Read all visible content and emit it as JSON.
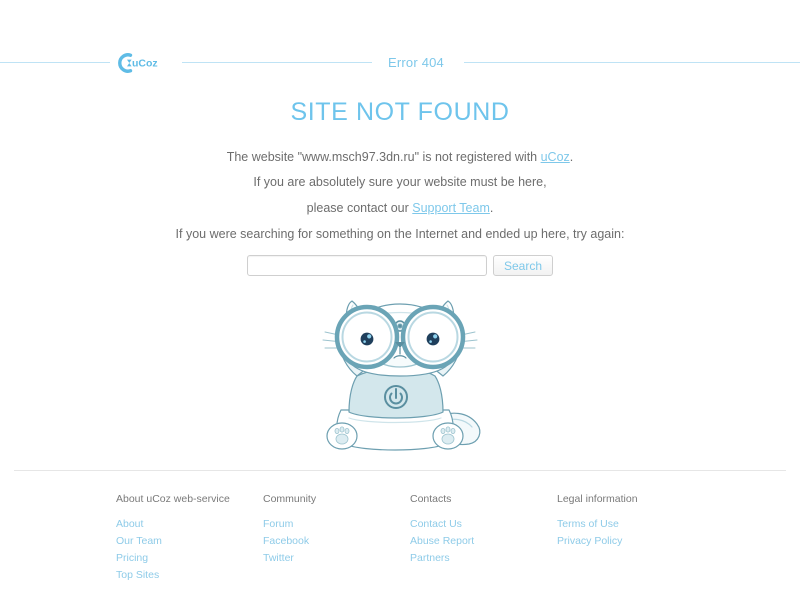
{
  "header": {
    "logo_text": "uCoz",
    "logo_icon": "ucoz-logo-icon",
    "error_code": "Error 404"
  },
  "main": {
    "title": "SITE NOT FOUND",
    "line1_prefix": "The website \"www.msch97.3dn.ru\" is not registered with ",
    "line1_link": "uCoz",
    "line1_suffix": ".",
    "line2": "If you are absolutely sure your website must be here,",
    "line3_prefix": "please contact our ",
    "line3_link": "Support Team",
    "line3_suffix": ".",
    "line4": "If you were searching for something on the Internet and ended up here, try again:"
  },
  "search": {
    "value": "",
    "placeholder": "",
    "button_label": "Search"
  },
  "mascot": {
    "name": "ucoz-cat-mascot",
    "shirt_logo": "ucoz-power-icon"
  },
  "footer": {
    "columns": [
      {
        "heading": "About uCoz web-service",
        "links": [
          "About",
          "Our Team",
          "Pricing",
          "Top Sites"
        ]
      },
      {
        "heading": "Community",
        "links": [
          "Forum",
          "Facebook",
          "Twitter"
        ]
      },
      {
        "heading": "Contacts",
        "links": [
          "Contact Us",
          "Abuse Report",
          "Partners"
        ]
      },
      {
        "heading": "Legal information",
        "links": [
          "Terms of Use",
          "Privacy Policy"
        ]
      }
    ]
  },
  "colors": {
    "brand_blue": "#7ec8ea",
    "title_blue": "#6ec4ec",
    "line_blue": "#bfe3f5",
    "text_gray": "#6d6d6d",
    "footer_heading": "#7a7a7a",
    "footer_link": "#8ecbe8",
    "divider_gray": "#e6e6e6",
    "mascot_outline": "#5a8fa0",
    "mascot_fill": "#ffffff",
    "mascot_shade": "#cfe4ea"
  }
}
